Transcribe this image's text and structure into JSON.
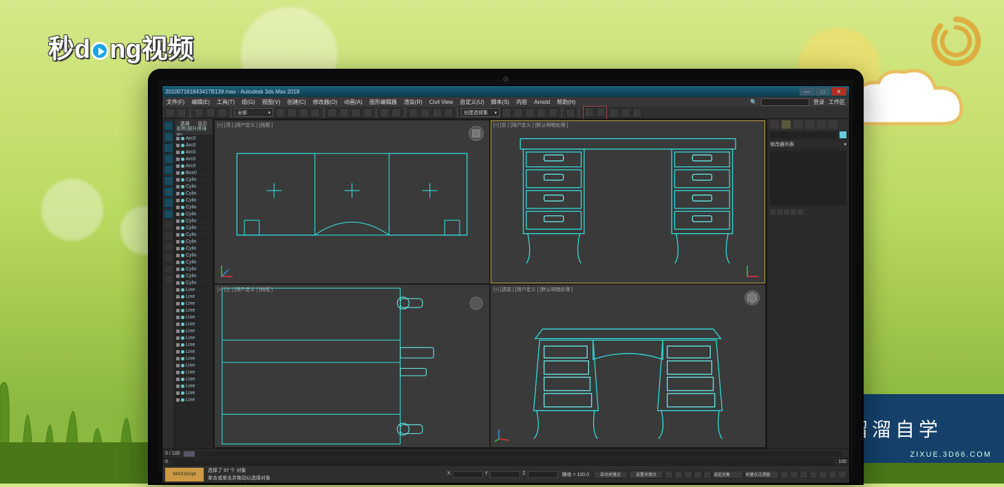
{
  "overlay": {
    "top_brand": "秒d▶ng视频",
    "bottom_brand": "溜溜自学",
    "bottom_url": "ZIXUE.3D66.COM"
  },
  "window": {
    "title": "201007161843417B139.max - Autodesk 3ds Max 2018",
    "buttons": {
      "min": "—",
      "max": "□",
      "close": "✕"
    }
  },
  "menu": {
    "items": [
      "文件(F)",
      "编辑(E)",
      "工具(T)",
      "组(G)",
      "视图(V)",
      "创建(C)",
      "修改器(O)",
      "动画(A)",
      "图形编辑器",
      "渲染(R)",
      "Civil View",
      "自定义(U)",
      "脚本(S)",
      "内容",
      "Arnold",
      "帮助(H)"
    ],
    "search_icon": "🔍",
    "search_label": "登录",
    "workspace": "工作区"
  },
  "toolbar": {
    "dropdown1": "全部",
    "dropdown2": "创建选择集"
  },
  "layer_panel": {
    "tabs": [
      "选择",
      "显示"
    ],
    "header": "名称(按升序排序)",
    "items": [
      "Arc0",
      "Arc0",
      "Arc0",
      "Arc0",
      "Arc0",
      "Box0",
      "Cylin",
      "Cylin",
      "Cylin",
      "Cylin",
      "Cylin",
      "Cylin",
      "Cylin",
      "Cylin",
      "Cylin",
      "Cylin",
      "Cylin",
      "Cylin",
      "Cylin",
      "Cylin",
      "Cylin",
      "Cylin",
      "Line",
      "Line",
      "Line",
      "Line",
      "Line",
      "Line",
      "Line",
      "Line",
      "Line",
      "Line",
      "Line",
      "Line",
      "Line",
      "Line",
      "Line",
      "Line",
      "Line"
    ]
  },
  "viewports": {
    "top_left": "[+] [顶 ] [用户定义 ] [线框 ]",
    "top_right": "[+] [前 ] [用户定义 ] [默认明暗处理 ]",
    "bottom_left": "[+] [左 ] [用户定义 ] [线框 ]",
    "bottom_right": "[+] [透视 ] [用户定义 ] [默认明暗处理 ]"
  },
  "right_panel": {
    "section1": "修改器列表"
  },
  "timeline": {
    "start": "0",
    "end": "100",
    "current": "0 / 100"
  },
  "status": {
    "script": "MAXScript",
    "line1": "选择了 97 个 对象",
    "line2": "单击或单击并拖动以选择对象",
    "grid_label": "栅格 = 100.0",
    "autokey": "自动关键点",
    "setkey": "设置关键点",
    "filter": "选定对象",
    "keyfilter": "关键点过滤器"
  }
}
